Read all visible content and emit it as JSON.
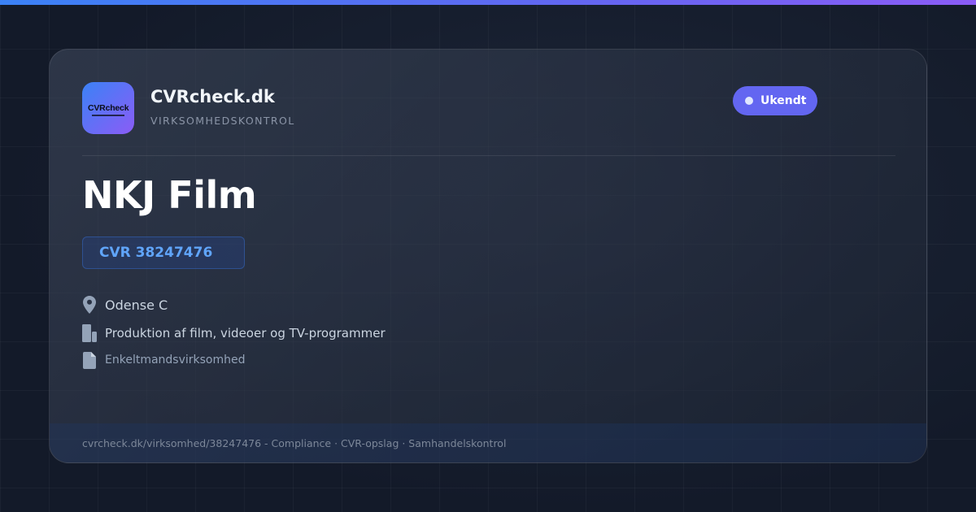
{
  "brand": {
    "logo_text": "CVRcheck",
    "name": "CVRcheck.dk",
    "tagline": "VIRKSOMHEDSKONTROL",
    "accent_colors": [
      "#3b82f6",
      "#6366f1",
      "#8b5cf6"
    ]
  },
  "status": {
    "label": "Ukendt",
    "color": "#6366f1"
  },
  "company": {
    "name": "NKJ Film",
    "cvr": "CVR 38247476",
    "location": "Odense C",
    "location_icon": "map-pin-icon",
    "industry": "Produktion af film, videoer og TV-programmer",
    "industry_icon": "building-icon",
    "type": "Enkeltmandsvirksomhed",
    "type_icon": "document-icon"
  },
  "footer": {
    "text": "cvrcheck.dk/virksomhed/38247476 - Compliance · CVR-opslag · Samhandelskontrol"
  }
}
